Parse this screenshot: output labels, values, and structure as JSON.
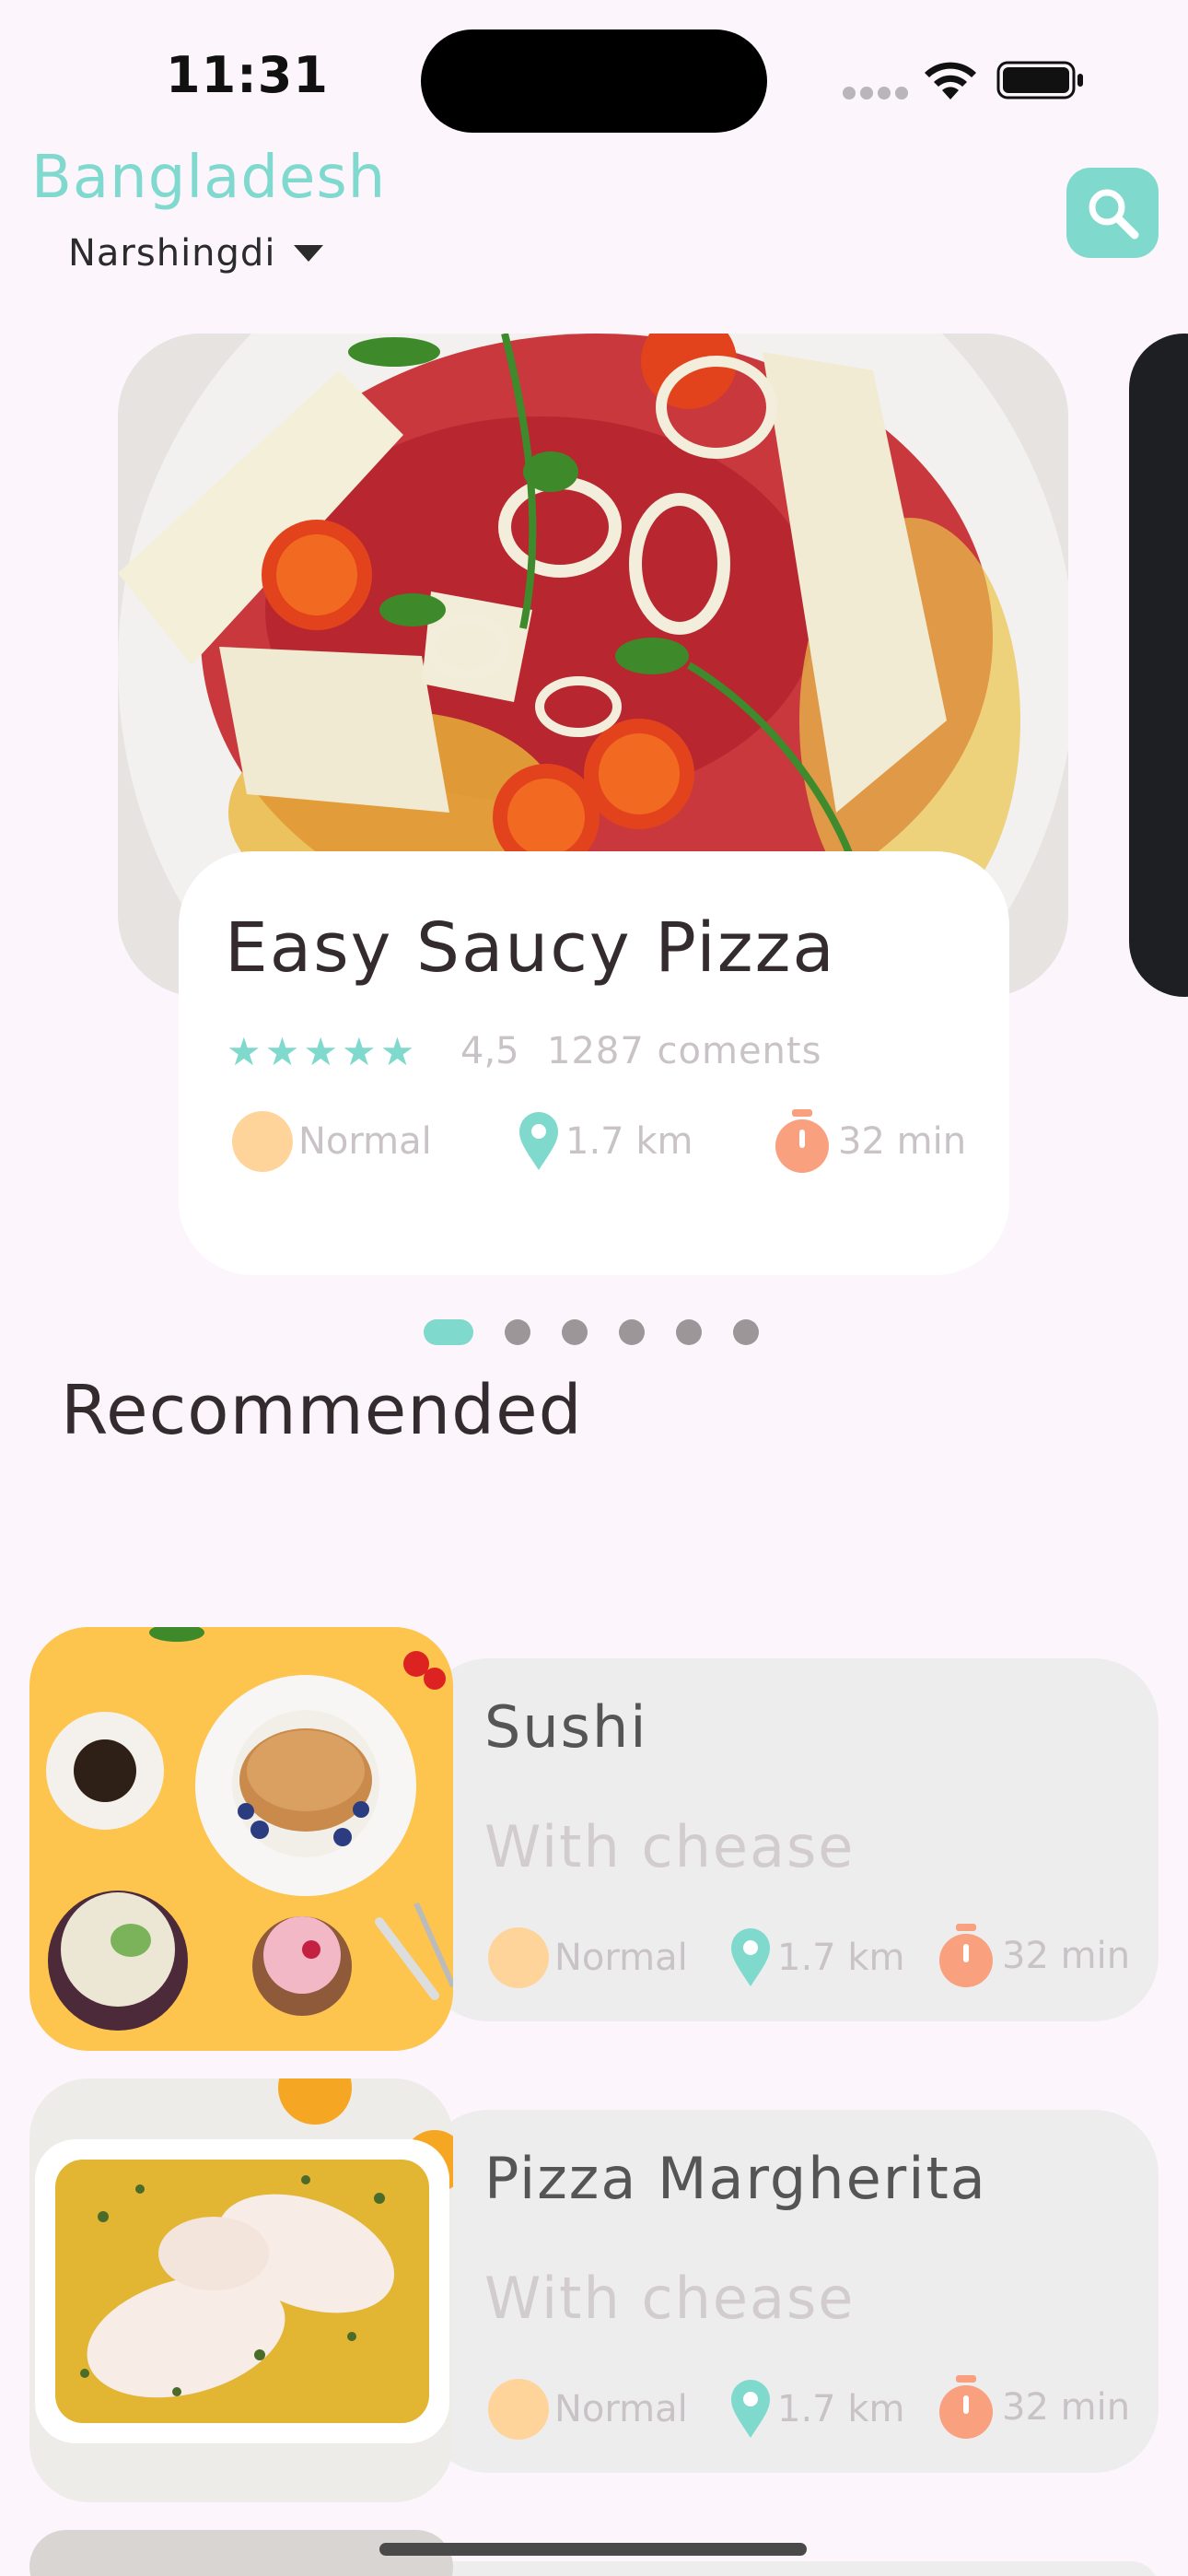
{
  "status_bar": {
    "time": "11:31"
  },
  "header": {
    "country": "Bangladesh",
    "city": "Narshingdi",
    "search_icon": "search-icon"
  },
  "featured": {
    "title": "Easy Saucy Pizza",
    "rating_stars": 5,
    "rating": "4,5",
    "comments": "1287 coments",
    "difficulty": "Normal",
    "distance": "1.7 km",
    "time": "32 min"
  },
  "pagination": {
    "count": 6,
    "active_index": 0
  },
  "recommended": {
    "title": "Recommended",
    "items": [
      {
        "title": "Sushi",
        "subtitle": "With chease",
        "difficulty": "Normal",
        "distance": "1.7 km",
        "time": "32 min"
      },
      {
        "title": "Pizza Margherita",
        "subtitle": "With chease",
        "difficulty": "Normal",
        "distance": "1.7 km",
        "time": "32 min"
      }
    ]
  },
  "colors": {
    "accent": "#7fd9cd",
    "background": "#fdf5fc",
    "difficulty_dot": "#ffd49a",
    "timer": "#f9a07f"
  }
}
